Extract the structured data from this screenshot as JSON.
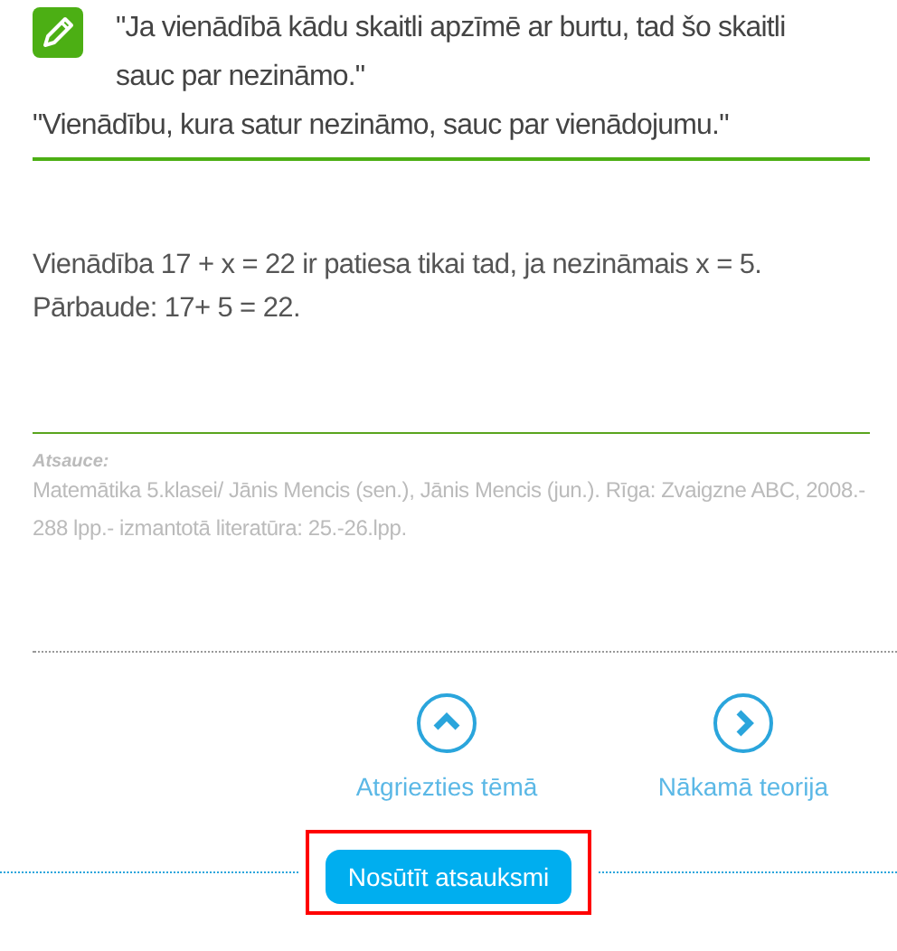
{
  "definition": {
    "quote_1": "\"Ja vienādībā kādu skaitli apzīmē ar burtu, tad šo skaitli sauc par nezināmo.\"",
    "quote_2": "\"Vienādību, kura satur nezināmo, sauc par vienādojumu.\""
  },
  "example": [
    "Vienādība 17 + x = 22 ir patiesa tikai tad, ja nezināmais x = 5.",
    "Pārbaude: 17+ 5 = 22."
  ],
  "reference": {
    "heading": "Atsauce:",
    "text": "Matemātika 5.klasei/ Jānis Mencis (sen.), Jānis Mencis (jun.). Rīga: Zvaigzne ABC, 2008.- 288 lpp.- izmantotā literatūra: 25.-26.lpp."
  },
  "navigation": [
    {
      "kind": "up",
      "label": "Atgriezties tēmā"
    },
    {
      "kind": "next",
      "label": "Nākamā teorija"
    }
  ],
  "feedback_button": {
    "label": "Nosūtīt atsauksmi",
    "highlighted": true
  }
}
